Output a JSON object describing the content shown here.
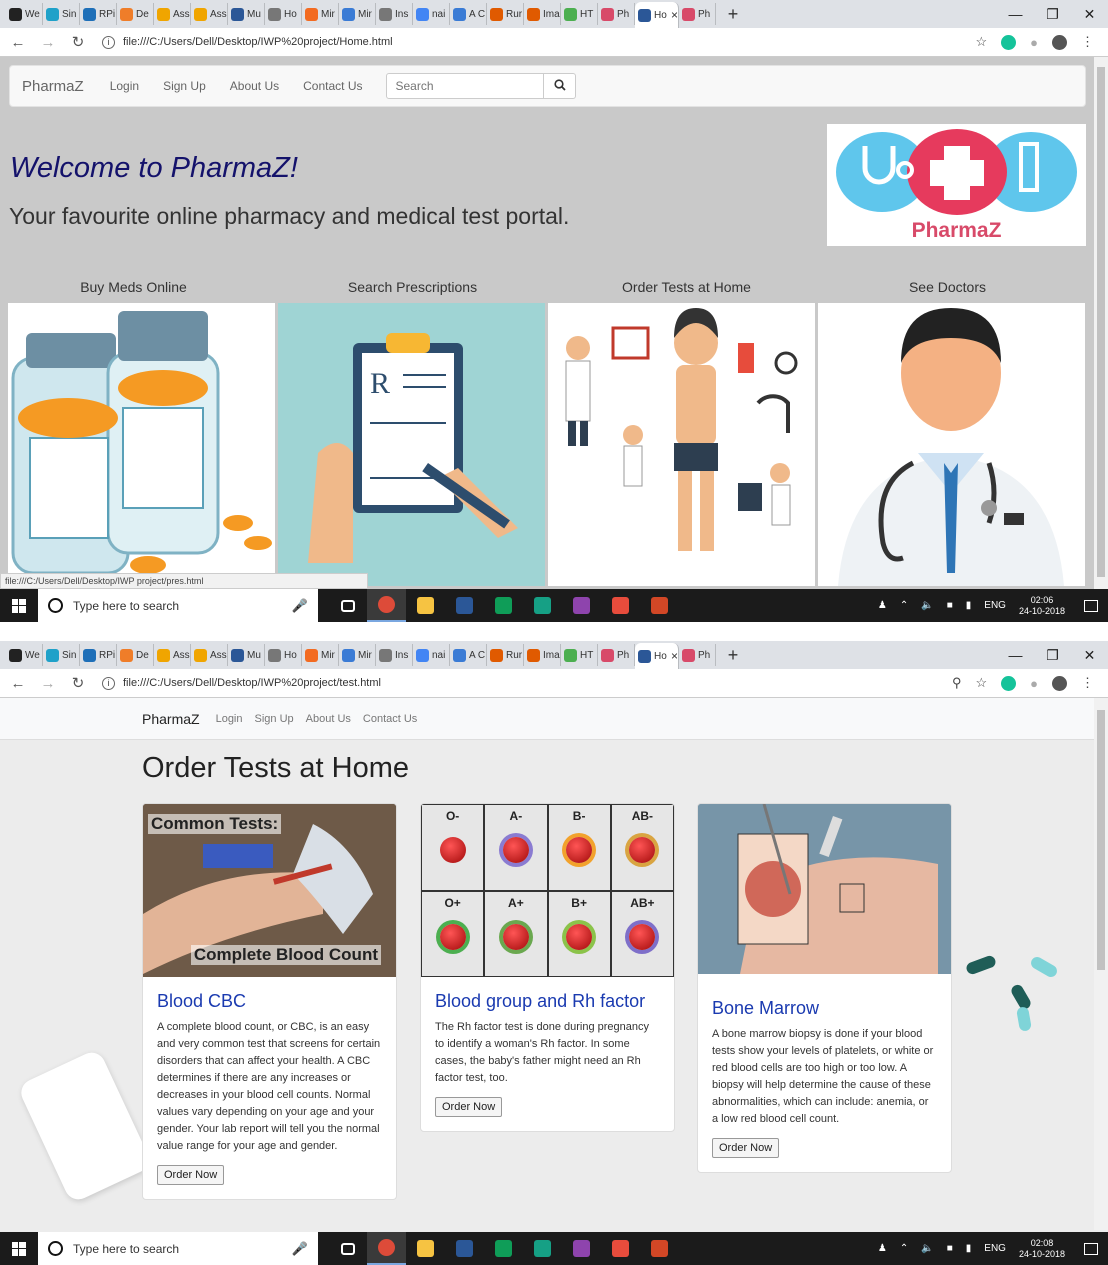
{
  "browser_tabs": [
    {
      "label": "We",
      "color": "#222222"
    },
    {
      "label": "Sin",
      "color": "#1fa1c9"
    },
    {
      "label": "RPi",
      "color": "#1e6fb8"
    },
    {
      "label": "De",
      "color": "#ef7d29"
    },
    {
      "label": "Ass",
      "color": "#f0a500"
    },
    {
      "label": "Ass",
      "color": "#f0a500"
    },
    {
      "label": "Mu",
      "color": "#2b5797"
    },
    {
      "label": "Ho",
      "color": "#777777"
    },
    {
      "label": "Mir",
      "color": "#f36b21"
    },
    {
      "label": "Mir",
      "color": "#3a7bd5"
    },
    {
      "label": "Ins",
      "color": "#777777"
    },
    {
      "label": "nai",
      "color": "#4285f4"
    },
    {
      "label": "A C",
      "color": "#3a7bd5"
    },
    {
      "label": "Rur",
      "color": "#e05a00"
    },
    {
      "label": "Ima",
      "color": "#e05a00"
    },
    {
      "label": "HT",
      "color": "#4caf50"
    },
    {
      "label": "Ph",
      "color": "#d84a69"
    },
    {
      "label": "Ho",
      "color": "#2b5797"
    },
    {
      "label": "Ph",
      "color": "#d84a69"
    }
  ],
  "shot1": {
    "url": "file:///C:/Users/Dell/Desktop/IWP%20project/Home.html",
    "status_url": "file:///C:/Users/Dell/Desktop/IWP project/pres.html",
    "nav": {
      "brand": "PharmaZ",
      "links": [
        "Login",
        "Sign Up",
        "About Us",
        "Contact Us"
      ],
      "search_placeholder": "Search"
    },
    "welcome": "Welcome to PharmaZ!",
    "tagline": "Your favourite online pharmacy and medical test portal.",
    "logo_text": "PharmaZ",
    "features": [
      "Buy Meds Online",
      "Search Prescriptions",
      "Order Tests at Home",
      "See Doctors"
    ],
    "clock_time": "02:06",
    "clock_date": "24-10-2018"
  },
  "shot2": {
    "url": "file:///C:/Users/Dell/Desktop/IWP%20project/test.html",
    "nav": {
      "brand": "PharmaZ",
      "links": [
        "Login",
        "Sign Up",
        "About Us",
        "Contact Us"
      ]
    },
    "page_title": "Order Tests at Home",
    "cards": [
      {
        "title": "Blood CBC",
        "text": "A complete blood count, or CBC, is an easy and very common test that screens for certain disorders that can affect your health. A CBC determines if there are any increases or decreases in your blood cell counts. Normal values vary depending on your age and your gender. Your lab report will tell you the normal value range for your age and gender.",
        "button": "Order Now",
        "image_caption_top": "Common Tests:",
        "image_caption_bottom": "Complete Blood Count"
      },
      {
        "title": "Blood group and Rh factor",
        "text": "The Rh factor test is done during pregnancy to identify a woman's Rh factor. In some cases, the baby's father might need an Rh factor test, too.",
        "button": "Order Now",
        "blood_groups": [
          "O-",
          "A-",
          "B-",
          "AB-",
          "O+",
          "A+",
          "B+",
          "AB+"
        ]
      },
      {
        "title": "Bone Marrow",
        "text": "A bone marrow biopsy is done if your blood tests show your levels of platelets, or white or red blood cells are too high or too low. A biopsy will help determine the cause of these abnormalities, which can include: anemia, or a low red blood cell count.",
        "button": "Order Now"
      }
    ],
    "clock_time": "02:08",
    "clock_date": "24-10-2018"
  },
  "taskbar": {
    "search_placeholder": "Type here to search",
    "lang": "ENG"
  }
}
